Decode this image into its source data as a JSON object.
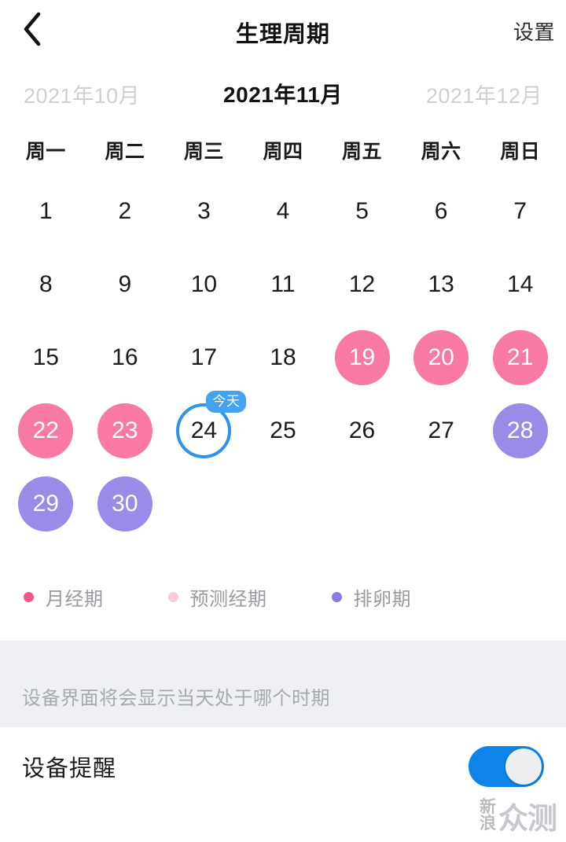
{
  "header": {
    "back_icon": "chevron-left-icon",
    "title": "生理周期",
    "action_label": "设置"
  },
  "month_switcher": {
    "prev": "2021年10月",
    "current": "2021年11月",
    "next": "2021年12月"
  },
  "calendar": {
    "weekdays": [
      "周一",
      "周二",
      "周三",
      "周四",
      "周五",
      "周六",
      "周日"
    ],
    "leading_blanks": 0,
    "today_badge": "今天",
    "days": [
      {
        "n": "1",
        "state": "normal"
      },
      {
        "n": "2",
        "state": "normal"
      },
      {
        "n": "3",
        "state": "normal"
      },
      {
        "n": "4",
        "state": "normal"
      },
      {
        "n": "5",
        "state": "normal"
      },
      {
        "n": "6",
        "state": "normal"
      },
      {
        "n": "7",
        "state": "normal"
      },
      {
        "n": "8",
        "state": "normal"
      },
      {
        "n": "9",
        "state": "normal"
      },
      {
        "n": "10",
        "state": "normal"
      },
      {
        "n": "11",
        "state": "normal"
      },
      {
        "n": "12",
        "state": "normal"
      },
      {
        "n": "13",
        "state": "normal"
      },
      {
        "n": "14",
        "state": "normal"
      },
      {
        "n": "15",
        "state": "normal"
      },
      {
        "n": "16",
        "state": "normal"
      },
      {
        "n": "17",
        "state": "normal"
      },
      {
        "n": "18",
        "state": "normal"
      },
      {
        "n": "19",
        "state": "period"
      },
      {
        "n": "20",
        "state": "period"
      },
      {
        "n": "21",
        "state": "period"
      },
      {
        "n": "22",
        "state": "period"
      },
      {
        "n": "23",
        "state": "period"
      },
      {
        "n": "24",
        "state": "today"
      },
      {
        "n": "25",
        "state": "normal"
      },
      {
        "n": "26",
        "state": "normal"
      },
      {
        "n": "27",
        "state": "normal"
      },
      {
        "n": "28",
        "state": "ovulation"
      },
      {
        "n": "29",
        "state": "ovulation"
      },
      {
        "n": "30",
        "state": "ovulation"
      }
    ]
  },
  "legend": [
    {
      "label": "月经期",
      "color": "#f5548c"
    },
    {
      "label": "预测经期",
      "color": "#fbc9d8"
    },
    {
      "label": "排卵期",
      "color": "#8b7ae8"
    }
  ],
  "note": {
    "text": "设备界面将会显示当天处于哪个时期"
  },
  "setting": {
    "label": "设备提醒",
    "toggle_on": true
  },
  "watermark": {
    "line1": "新",
    "line2": "浪",
    "big": "众测"
  },
  "colors": {
    "period": "#f87aa4",
    "predicted": "#fbc9d8",
    "ovulation": "#9b8ae8",
    "today_ring": "#2b95ee",
    "today_badge": "#43a3f0",
    "toggle_on": "#0d84e8",
    "note_band": "#eef0f4",
    "muted_text": "#9a9aa0"
  }
}
